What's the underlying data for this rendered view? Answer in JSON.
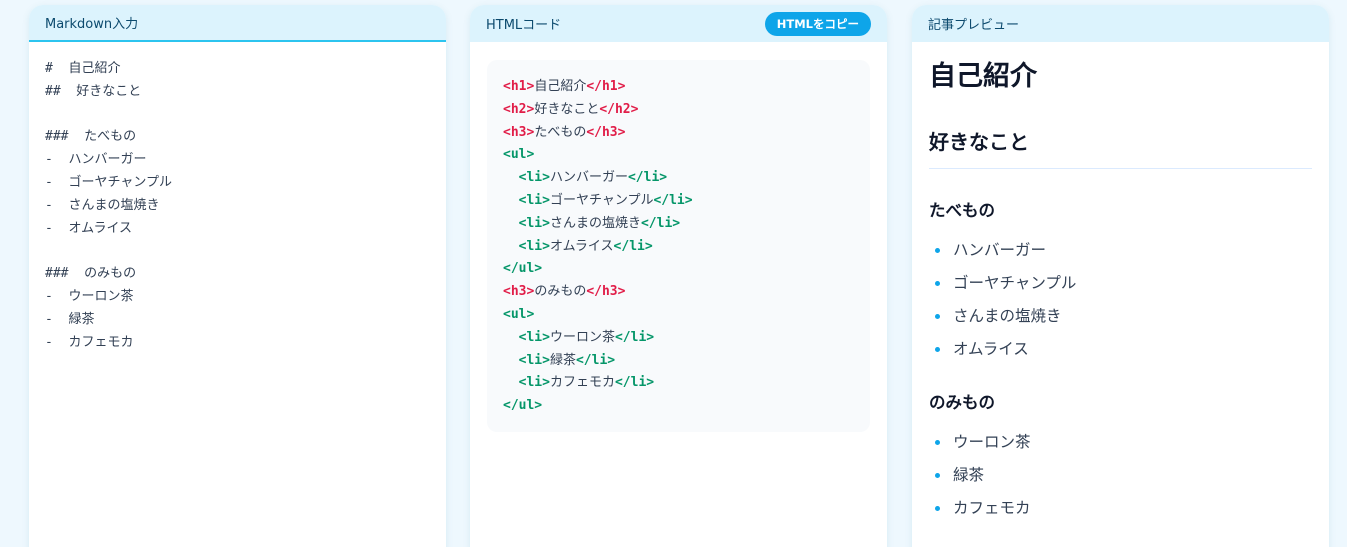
{
  "markdown_panel": {
    "title": "Markdown入力",
    "lines": [
      "#  自己紹介",
      "##  好きなこと",
      "",
      "###  たべもの",
      "-  ハンバーガー",
      "-  ゴーヤチャンプル",
      "-  さんまの塩焼き",
      "-  オムライス",
      "",
      "###  のみもの",
      "-  ウーロン茶",
      "-  緑茶",
      "-  カフェモカ"
    ]
  },
  "html_panel": {
    "title": "HTMLコード",
    "copy_label": "HTMLをコピー",
    "code": [
      {
        "indent": false,
        "open": "<h1>",
        "text": "自己紹介",
        "close": "</h1>",
        "kind": "h"
      },
      {
        "indent": false,
        "open": "<h2>",
        "text": "好きなこと",
        "close": "</h2>",
        "kind": "h"
      },
      {
        "indent": false,
        "open": "<h3>",
        "text": "たべもの",
        "close": "</h3>",
        "kind": "h"
      },
      {
        "indent": false,
        "open": "<ul>",
        "text": "",
        "close": "",
        "kind": "l"
      },
      {
        "indent": true,
        "open": "<li>",
        "text": "ハンバーガー",
        "close": "</li>",
        "kind": "l"
      },
      {
        "indent": true,
        "open": "<li>",
        "text": "ゴーヤチャンプル",
        "close": "</li>",
        "kind": "l"
      },
      {
        "indent": true,
        "open": "<li>",
        "text": "さんまの塩焼き",
        "close": "</li>",
        "kind": "l"
      },
      {
        "indent": true,
        "open": "<li>",
        "text": "オムライス",
        "close": "</li>",
        "kind": "l"
      },
      {
        "indent": false,
        "open": "</ul>",
        "text": "",
        "close": "",
        "kind": "l"
      },
      {
        "indent": false,
        "open": "<h3>",
        "text": "のみもの",
        "close": "</h3>",
        "kind": "h"
      },
      {
        "indent": false,
        "open": "<ul>",
        "text": "",
        "close": "",
        "kind": "l"
      },
      {
        "indent": true,
        "open": "<li>",
        "text": "ウーロン茶",
        "close": "</li>",
        "kind": "l"
      },
      {
        "indent": true,
        "open": "<li>",
        "text": "緑茶",
        "close": "</li>",
        "kind": "l"
      },
      {
        "indent": true,
        "open": "<li>",
        "text": "カフェモカ",
        "close": "</li>",
        "kind": "l"
      },
      {
        "indent": false,
        "open": "</ul>",
        "text": "",
        "close": "",
        "kind": "l"
      }
    ]
  },
  "preview_panel": {
    "title": "記事プレビュー",
    "h1": "自己紹介",
    "h2": "好きなこと",
    "sections": [
      {
        "heading": "たべもの",
        "items": [
          "ハンバーガー",
          "ゴーヤチャンプル",
          "さんまの塩焼き",
          "オムライス"
        ]
      },
      {
        "heading": "のみもの",
        "items": [
          "ウーロン茶",
          "緑茶",
          "カフェモカ"
        ]
      }
    ]
  },
  "colors": {
    "accent": "#0ea5e9",
    "header_bg": "#dcf3fd",
    "heading_tag": "#e11d48",
    "list_tag": "#059669"
  }
}
